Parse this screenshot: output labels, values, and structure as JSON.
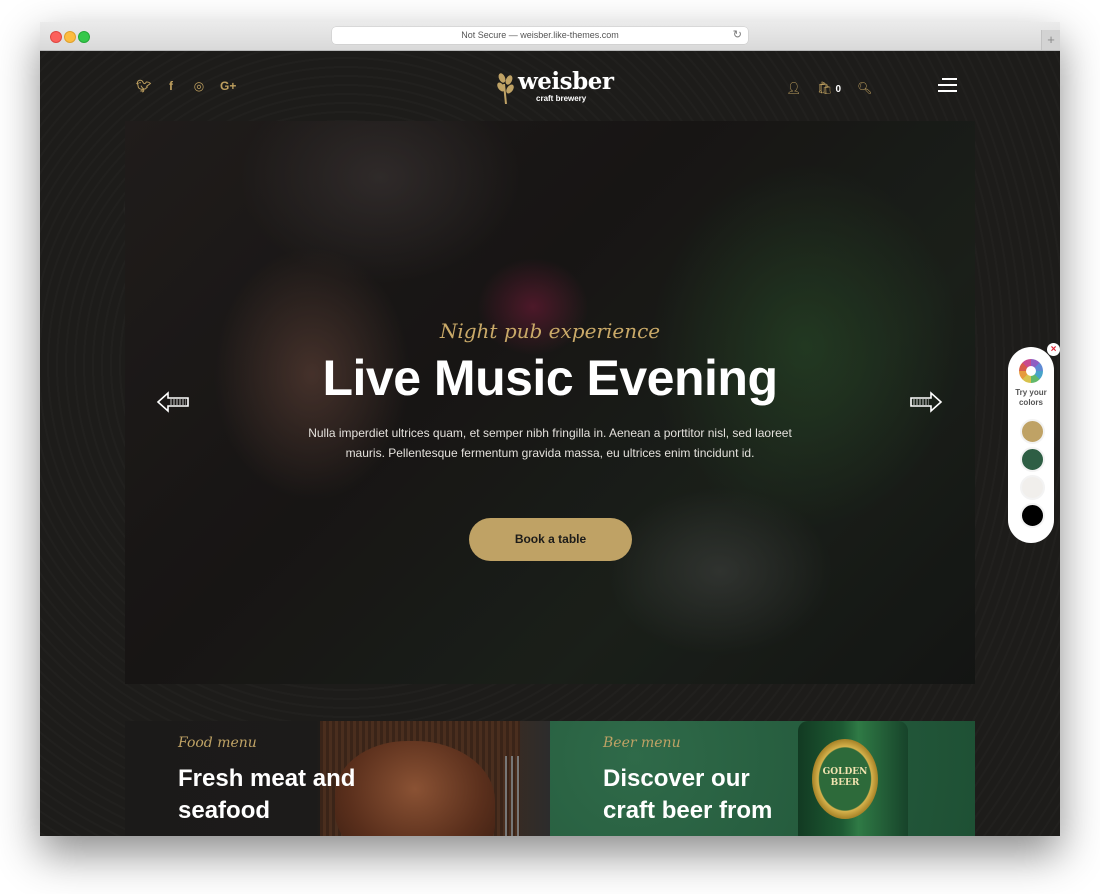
{
  "browser": {
    "url_text": "Not Secure — weisber.like-themes.com",
    "reload_icon": "↻",
    "new_tab_icon": "+"
  },
  "header": {
    "social": [
      {
        "name": "twitter",
        "glyph": "🐦︎"
      },
      {
        "name": "facebook",
        "glyph": "f"
      },
      {
        "name": "instagram",
        "glyph": "◎"
      },
      {
        "name": "google-plus",
        "glyph": "G+"
      }
    ],
    "logo": {
      "word": "weisber",
      "subtitle": "craft brewery"
    },
    "cart_count": "0",
    "icons": {
      "user": "👤︎",
      "cart": "🛍︎",
      "search": "🔍︎"
    }
  },
  "hero": {
    "tagline": "Night pub experience",
    "title": "Live Music Evening",
    "description": "Nulla imperdiet ultrices quam, et semper nibh fringilla in. Aenean a porttitor nisl, sed laoreet mauris. Pellentesque fermentum gravida massa, eu ultrices enim tincidunt id.",
    "button_label": "Book a table"
  },
  "color_switcher": {
    "close_icon": "×",
    "label_line1": "Try your",
    "label_line2": "colors",
    "swatches": [
      "#bfa265",
      "#2e5e44",
      "#f1efec",
      "#000000"
    ]
  },
  "cards": {
    "food": {
      "label": "Food menu",
      "title": "Fresh meat and seafood"
    },
    "beer": {
      "label": "Beer menu",
      "title": "Discover our craft beer from",
      "bottle_text": "GOLDEN BEER"
    }
  }
}
